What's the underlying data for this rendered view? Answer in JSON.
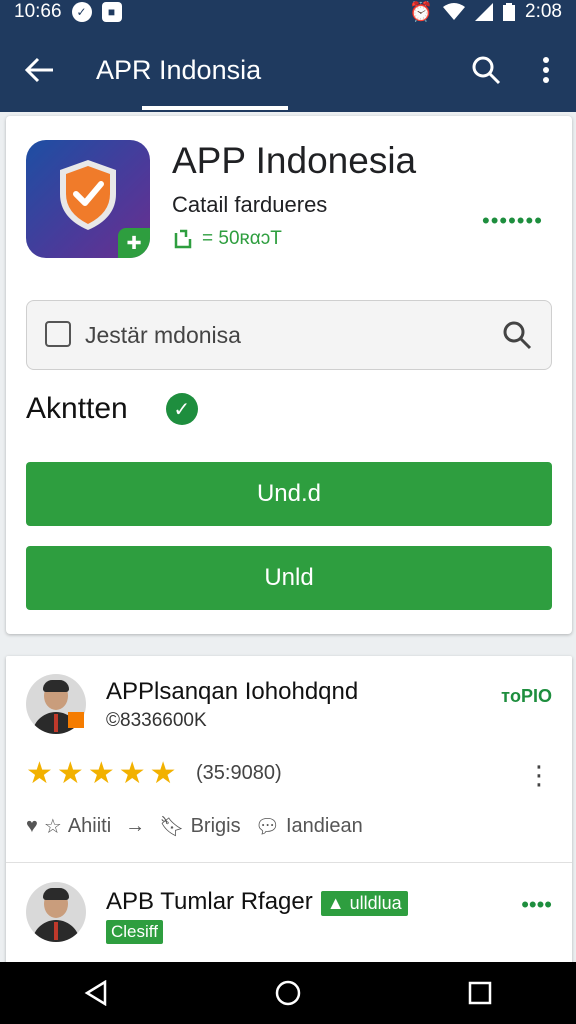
{
  "status_bar": {
    "time_left": "10:66",
    "time_right": "2:08"
  },
  "app_bar": {
    "title": "APR Indonsia",
    "icons": [
      "back-arrow-icon",
      "search-icon",
      "more-vert-icon"
    ]
  },
  "app": {
    "name": "APP Indonesia",
    "developer": "Catail fardueres",
    "meta": "= 50ʀαɔT"
  },
  "search": {
    "placeholder": "Jestär mdonisa"
  },
  "status": {
    "label": "Akntten"
  },
  "buttons": {
    "primary": "Und.d",
    "secondary": "Unld"
  },
  "reviews": [
    {
      "name": "APPlsanqan Iohohdqnd",
      "subtitle": "©8336600K",
      "tag": "ᴛoPIO",
      "rating": 5,
      "rating_count": "(35:9080)",
      "actions": [
        "Ahiiti",
        "Brigis",
        "Iandiean"
      ]
    },
    {
      "name": "APB Tumlar Rfager",
      "pill": "▲ ulldlua",
      "chip": "Clesiff"
    }
  ],
  "colors": {
    "app_bar": "#1f3a5f",
    "accent_green": "#2e9e3f",
    "star": "#f2b100",
    "badge_orange": "#f57c00"
  }
}
